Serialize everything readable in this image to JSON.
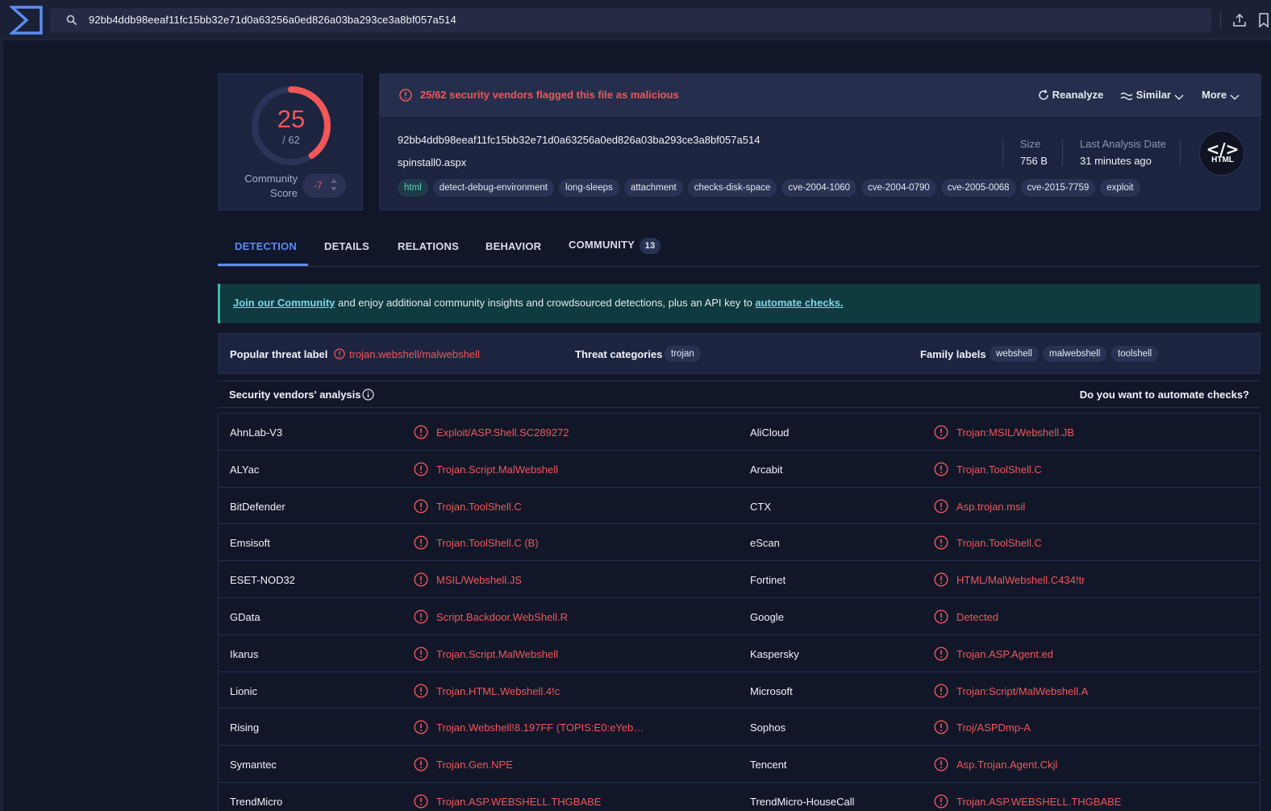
{
  "search": {
    "value": "92bb4ddb98eeaf11fc15bb32e71d0a63256a0ed826a03ba293ce3a8bf057a514"
  },
  "score": {
    "detections": "25",
    "total": "/ 62",
    "detected_fraction": 0.403,
    "community_label": "Community Score",
    "community_value": "-7"
  },
  "alert": {
    "text": "25/62 security vendors flagged this file as malicious"
  },
  "actions": {
    "reanalyze": "Reanalyze",
    "similar": "Similar",
    "more": "More"
  },
  "file": {
    "hash": "92bb4ddb98eeaf11fc15bb32e71d0a63256a0ed826a03ba293ce3a8bf057a514",
    "name": "spinstall0.aspx",
    "tags": [
      "html",
      "detect-debug-environment",
      "long-sleeps",
      "attachment",
      "checks-disk-space",
      "cve-2004-1060",
      "cve-2004-0790",
      "cve-2005-0068",
      "cve-2015-7759",
      "exploit"
    ],
    "size_label": "Size",
    "size_value": "756 B",
    "date_label": "Last Analysis Date",
    "date_value": "31 minutes ago",
    "type_badge_code": "</>",
    "type_badge_label": "HTML"
  },
  "tabs": [
    {
      "label": "DETECTION",
      "active": true
    },
    {
      "label": "DETAILS"
    },
    {
      "label": "RELATIONS"
    },
    {
      "label": "BEHAVIOR"
    },
    {
      "label": "COMMUNITY",
      "count": "13"
    }
  ],
  "banner": {
    "link1": "Join our Community",
    "middle": " and enjoy additional community insights and crowdsourced detections, plus an API key to ",
    "link2": "automate checks."
  },
  "threat": {
    "popular_label": "Popular threat label",
    "popular_value": "trojan.webshell/malwebshell",
    "categories_label": "Threat categories",
    "categories": [
      "trojan"
    ],
    "family_label": "Family labels",
    "families": [
      "webshell",
      "malwebshell",
      "toolshell"
    ]
  },
  "vendors": {
    "title": "Security vendors' analysis",
    "automate_prompt": "Do you want to automate checks?",
    "rows": [
      {
        "left_name": "AhnLab-V3",
        "left_result": "Exploit/ASP.Shell.SC289272",
        "right_name": "AliCloud",
        "right_result": "Trojan:MSIL/Webshell.JB"
      },
      {
        "left_name": "ALYac",
        "left_result": "Trojan.Script.MalWebshell",
        "right_name": "Arcabit",
        "right_result": "Trojan.ToolShell.C"
      },
      {
        "left_name": "BitDefender",
        "left_result": "Trojan.ToolShell.C",
        "right_name": "CTX",
        "right_result": "Asp.trojan.msil"
      },
      {
        "left_name": "Emsisoft",
        "left_result": "Trojan.ToolShell.C (B)",
        "right_name": "eScan",
        "right_result": "Trojan.ToolShell.C"
      },
      {
        "left_name": "ESET-NOD32",
        "left_result": "MSIL/Webshell.JS",
        "right_name": "Fortinet",
        "right_result": "HTML/MalWebshell.C434!tr"
      },
      {
        "left_name": "GData",
        "left_result": "Script.Backdoor.WebShell.R",
        "right_name": "Google",
        "right_result": "Detected"
      },
      {
        "left_name": "Ikarus",
        "left_result": "Trojan.Script.MalWebshell",
        "right_name": "Kaspersky",
        "right_result": "Trojan.ASP.Agent.ed"
      },
      {
        "left_name": "Lionic",
        "left_result": "Trojan.HTML.Webshell.4!c",
        "right_name": "Microsoft",
        "right_result": "Trojan:Script/MalWebshell.A"
      },
      {
        "left_name": "Rising",
        "left_result": "Trojan.Webshell!8.197FF (TOPIS:E0:eYeb…",
        "right_name": "Sophos",
        "right_result": "Troj/ASPDmp-A"
      },
      {
        "left_name": "Symantec",
        "left_result": "Trojan.Gen.NPE",
        "right_name": "Tencent",
        "right_result": "Asp.Trojan.Agent.Ckjl"
      },
      {
        "left_name": "TrendMicro",
        "left_result": "Trojan.ASP.WEBSHELL.THGBABE",
        "right_name": "TrendMicro-HouseCall",
        "right_result": "Trojan.ASP.WEBSHELL.THGBABE"
      }
    ]
  },
  "colors": {
    "malicious": "#f25757",
    "accent": "#5b8cf2",
    "background": "#111629",
    "card": "#1c2440"
  }
}
